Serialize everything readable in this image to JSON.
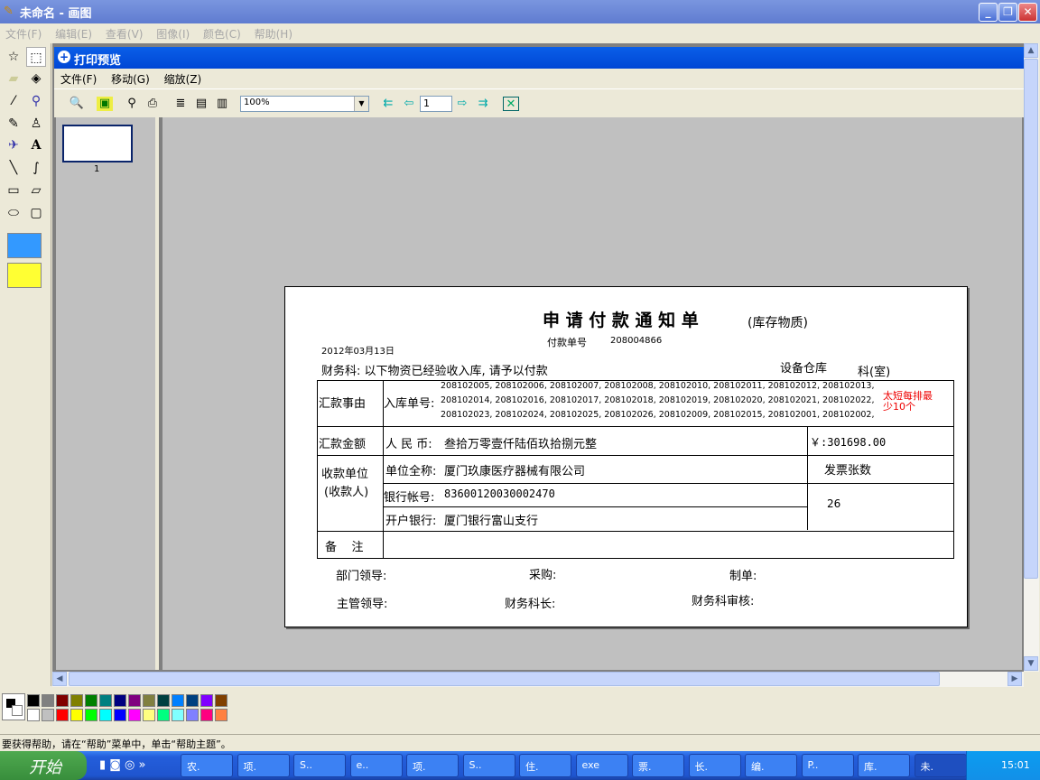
{
  "window": {
    "title": "未命名 - 画图",
    "minimize": "_",
    "maximize": "❐",
    "close": "✕"
  },
  "menu": [
    "文件(F)",
    "编辑(E)",
    "查看(V)",
    "图像(I)",
    "颜色(C)",
    "帮助(H)"
  ],
  "print_preview": {
    "title": "打印预览",
    "menu": [
      "文件(F)",
      "移动(G)",
      "缩放(Z)"
    ],
    "zoom": "100%",
    "page": "1",
    "thumbnail_label": "1"
  },
  "document": {
    "title": "申 请 付 款 通 知 单",
    "subtitle": "(库存物质)",
    "payment_no_label": "付款单号",
    "payment_no": "208004866",
    "date": "2012年03月13日",
    "intro": "财务科: 以下物资已经验收入库, 请予以付款",
    "dept": "设备仓库",
    "dept_suffix": "科(室)",
    "reason_label": "汇款事由",
    "receipt_label": "入库单号:",
    "receipt_lines": [
      "208102005, 208102006, 208102007, 208102008, 208102010, 208102011, 208102012, 208102013,",
      "208102014, 208102016, 208102017, 208102018, 208102019, 208102020, 208102021, 208102022,",
      "208102023, 208102024, 208102025, 208102026, 208102009, 208102015, 208102001, 208102002,"
    ],
    "note_red": [
      "太短每排最",
      "少10个"
    ],
    "amount_label": "汇款金额",
    "rmb_label": "人 民 币:",
    "amount_words": "叁拾万零壹仟陆佰玖拾捌元整",
    "amount_num": "￥:301698.00",
    "payee_label": "收款单位",
    "payee_label2": "(收款人)",
    "company_label": "单位全称:",
    "company": "厦门玖康医疗器械有限公司",
    "invoice_label": "发票张数",
    "account_label": "银行帐号:",
    "account": "83600120030002470",
    "invoice_count": "26",
    "bank_label": "开户银行:",
    "bank": "厦门银行富山支行",
    "remark_label": "备    注",
    "signs": [
      "部门领导:",
      "采购:",
      "制单:",
      "主管领导:",
      "财务科长:",
      "财务科审核:"
    ]
  },
  "palette": {
    "primary": "#000000",
    "secondary": "#ffffff",
    "top": [
      "#000000",
      "#808080",
      "#800000",
      "#808000",
      "#008000",
      "#008080",
      "#000080",
      "#800080",
      "#808040",
      "#004040",
      "#0080ff",
      "#004080",
      "#8000ff",
      "#804000"
    ],
    "bottom": [
      "#ffffff",
      "#c0c0c0",
      "#ff0000",
      "#ffff00",
      "#00ff00",
      "#00ffff",
      "#0000ff",
      "#ff00ff",
      "#ffff80",
      "#00ff80",
      "#80ffff",
      "#8080ff",
      "#ff0080",
      "#ff8040"
    ]
  },
  "status": "要获得帮助，请在“帮助”菜单中，单击“帮助主题”。",
  "taskbar": {
    "start": "开始",
    "tasks": [
      "农.",
      "项.",
      "S..",
      "e..",
      "项.",
      "S..",
      "住.",
      "exe",
      "票.",
      "长.",
      "编.",
      "P..",
      "库.",
      "未."
    ],
    "clock": "15:01"
  }
}
